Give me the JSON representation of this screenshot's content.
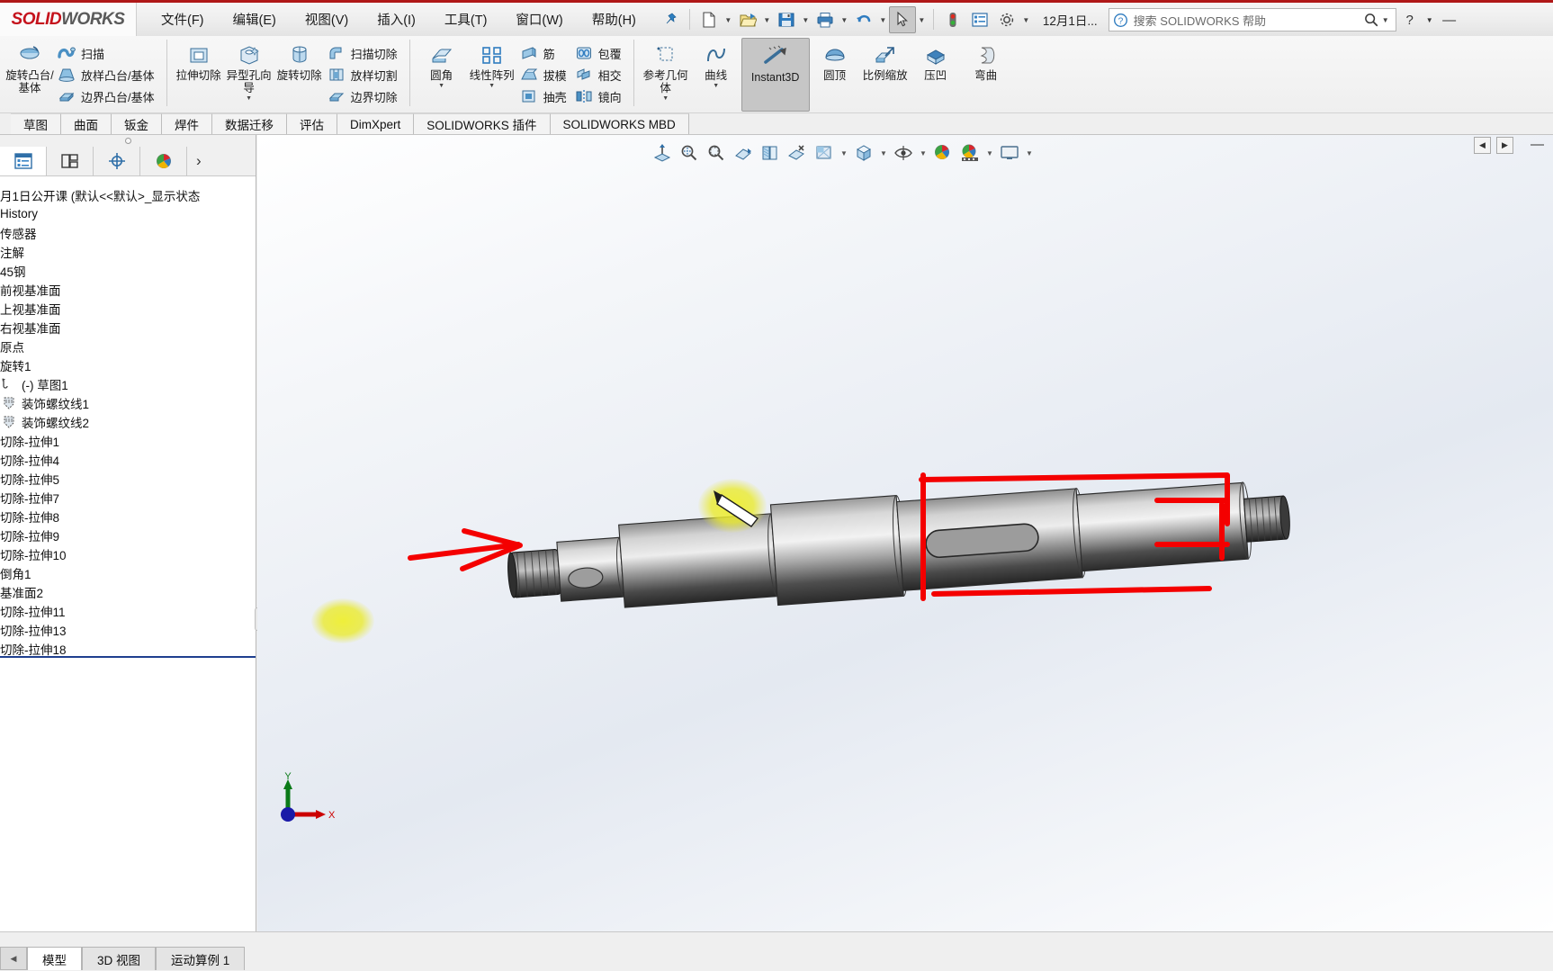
{
  "app": {
    "logo_solid": "SOLID",
    "logo_works": "WORKS"
  },
  "menubar": {
    "items": [
      {
        "label": "文件(F)"
      },
      {
        "label": "编辑(E)"
      },
      {
        "label": "视图(V)"
      },
      {
        "label": "插入(I)"
      },
      {
        "label": "工具(T)"
      },
      {
        "label": "窗口(W)"
      },
      {
        "label": "帮助(H)"
      }
    ],
    "pin_icon": "pushpin-icon"
  },
  "quickaccess": {
    "buttons": [
      {
        "name": "new-document-button",
        "icon": "new-document-icon",
        "caret": true
      },
      {
        "name": "open-document-button",
        "icon": "open-folder-icon",
        "caret": true
      },
      {
        "name": "save-button",
        "icon": "save-floppy-icon",
        "caret": true
      },
      {
        "name": "print-button",
        "icon": "printer-icon",
        "caret": true
      },
      {
        "name": "undo-button",
        "icon": "undo-arrow-icon",
        "caret": true
      },
      {
        "name": "select-button",
        "icon": "cursor-arrow-icon",
        "caret": true
      },
      {
        "name": "rebuild-button",
        "icon": "traffic-light-icon",
        "caret": false
      },
      {
        "name": "options-list-button",
        "icon": "list-properties-icon",
        "caret": false
      },
      {
        "name": "settings-button",
        "icon": "gear-icon",
        "caret": true
      }
    ],
    "document_title": "12月1日...",
    "help_search_placeholder": "搜索 SOLIDWORKS 帮助",
    "help_icon": "question-circle-icon",
    "search_icon": "magnifier-icon",
    "help_button": "?",
    "minimize_label": "—"
  },
  "ribbon": {
    "groups": [
      {
        "big": [
          {
            "label": "旋转凸台/基体",
            "icon": "revolve-boss-icon",
            "caret": false
          }
        ],
        "small": [
          {
            "label": "扫描",
            "icon": "sweep-icon"
          },
          {
            "label": "放样凸台/基体",
            "icon": "loft-boss-icon"
          },
          {
            "label": "边界凸台/基体",
            "icon": "boundary-boss-icon"
          }
        ]
      },
      {
        "big": [
          {
            "label": "拉伸切除",
            "icon": "extruded-cut-icon",
            "caret": false
          },
          {
            "label": "异型孔向导",
            "icon": "hole-wizard-icon",
            "caret": true
          },
          {
            "label": "旋转切除",
            "icon": "revolved-cut-icon",
            "caret": false
          }
        ],
        "small": [
          {
            "label": "扫描切除",
            "icon": "swept-cut-icon"
          },
          {
            "label": "放样切割",
            "icon": "lofted-cut-icon"
          },
          {
            "label": "边界切除",
            "icon": "boundary-cut-icon"
          }
        ]
      },
      {
        "big": [
          {
            "label": "圆角",
            "icon": "fillet-icon",
            "caret": true
          },
          {
            "label": "线性阵列",
            "icon": "linear-pattern-icon",
            "caret": true
          }
        ],
        "small": [
          {
            "label": "筋",
            "icon": "rib-icon"
          },
          {
            "label": "拔模",
            "icon": "draft-icon"
          },
          {
            "label": "抽壳",
            "icon": "shell-icon"
          }
        ],
        "small2": [
          {
            "label": "包覆",
            "icon": "wrap-icon"
          },
          {
            "label": "相交",
            "icon": "intersect-icon"
          },
          {
            "label": "镜向",
            "icon": "mirror-icon"
          }
        ]
      },
      {
        "big": [
          {
            "label": "参考几何体",
            "icon": "reference-geometry-icon",
            "caret": true
          },
          {
            "label": "曲线",
            "icon": "curves-icon",
            "caret": true
          },
          {
            "label": "Instant3D",
            "icon": "instant3d-icon",
            "caret": false,
            "active": true
          },
          {
            "label": "圆顶",
            "icon": "dome-icon",
            "caret": false
          },
          {
            "label": "比例缩放",
            "icon": "scale-icon",
            "caret": false
          },
          {
            "label": "压凹",
            "icon": "indent-icon",
            "caret": false
          },
          {
            "label": "弯曲",
            "icon": "flex-icon",
            "caret": false
          }
        ],
        "small": []
      }
    ]
  },
  "command_tabs": {
    "items": [
      {
        "label": "草图"
      },
      {
        "label": "曲面"
      },
      {
        "label": "钣金"
      },
      {
        "label": "焊件"
      },
      {
        "label": "数据迁移"
      },
      {
        "label": "评估"
      },
      {
        "label": "DimXpert"
      },
      {
        "label": "SOLIDWORKS 插件"
      },
      {
        "label": "SOLIDWORKS MBD"
      }
    ]
  },
  "left_panel": {
    "tabs": [
      {
        "name": "feature-manager-tab",
        "icon": "feature-tree-icon",
        "selected": true
      },
      {
        "name": "property-manager-tab",
        "icon": "property-manager-icon",
        "selected": false
      },
      {
        "name": "configuration-manager-tab",
        "icon": "configuration-icon",
        "selected": false
      },
      {
        "name": "display-manager-tab",
        "icon": "display-palette-icon",
        "selected": false
      }
    ],
    "expand_arrow": "›",
    "tree": [
      {
        "label": "月1日公开课  (默认<<默认>_显示状态",
        "icon": "part-icon",
        "indent": 0
      },
      {
        "label": "History",
        "icon": "history-icon",
        "indent": 0
      },
      {
        "label": "传感器",
        "icon": "sensors-icon",
        "indent": 0
      },
      {
        "label": "注解",
        "icon": "annotations-icon",
        "indent": 0
      },
      {
        "label": "45钢",
        "icon": "material-icon",
        "indent": 0
      },
      {
        "label": "前视基准面",
        "icon": "plane-icon",
        "indent": 0
      },
      {
        "label": "上视基准面",
        "icon": "plane-icon",
        "indent": 0
      },
      {
        "label": "右视基准面",
        "icon": "plane-icon",
        "indent": 0
      },
      {
        "label": "原点",
        "icon": "origin-icon",
        "indent": 0
      },
      {
        "label": "旋转1",
        "icon": "revolve-feature-icon",
        "indent": 0
      },
      {
        "label": "(-) 草图1",
        "icon": "sketch-icon",
        "indent": 1
      },
      {
        "label": "装饰螺纹线1",
        "icon": "cosmetic-thread-icon",
        "indent": 1
      },
      {
        "label": "装饰螺纹线2",
        "icon": "cosmetic-thread-icon",
        "indent": 1
      },
      {
        "label": "切除-拉伸1",
        "icon": "extrude-cut-feature-icon",
        "indent": 0
      },
      {
        "label": "切除-拉伸4",
        "icon": "extrude-cut-feature-icon",
        "indent": 0
      },
      {
        "label": "切除-拉伸5",
        "icon": "extrude-cut-feature-icon",
        "indent": 0
      },
      {
        "label": "切除-拉伸7",
        "icon": "extrude-cut-feature-icon",
        "indent": 0
      },
      {
        "label": "切除-拉伸8",
        "icon": "extrude-cut-feature-icon",
        "indent": 0
      },
      {
        "label": "切除-拉伸9",
        "icon": "extrude-cut-feature-icon",
        "indent": 0
      },
      {
        "label": "切除-拉伸10",
        "icon": "extrude-cut-feature-icon",
        "indent": 0
      },
      {
        "label": "倒角1",
        "icon": "chamfer-feature-icon",
        "indent": 0
      },
      {
        "label": "基准面2",
        "icon": "plane-icon",
        "indent": 0
      },
      {
        "label": "切除-拉伸11",
        "icon": "extrude-cut-feature-icon",
        "indent": 0
      },
      {
        "label": "切除-拉伸13",
        "icon": "extrude-cut-feature-icon",
        "indent": 0
      },
      {
        "label": "切除-拉伸18",
        "icon": "extrude-cut-feature-icon",
        "indent": 0
      }
    ],
    "hscroll_grip": "⋯"
  },
  "heads_up_toolbar": {
    "buttons": [
      {
        "name": "zoom-to-fit-button",
        "icon": "zoom-to-fit-icon",
        "caret": false
      },
      {
        "name": "zoom-to-area-button",
        "icon": "zoom-to-area-icon",
        "caret": false
      },
      {
        "name": "previous-view-button",
        "icon": "previous-view-icon",
        "caret": false
      },
      {
        "name": "section-view-button",
        "icon": "section-view-icon",
        "caret": false
      },
      {
        "name": "view-orientation-button",
        "icon": "view-orientation-icon",
        "caret": false
      },
      {
        "name": "display-style-button",
        "icon": "display-style-icon",
        "caret": false
      },
      {
        "name": "hide-show-items-button",
        "icon": "hide-show-items-icon",
        "caret": true
      },
      {
        "name": "view-settings-button",
        "icon": "view-cube-icon",
        "caret": true
      },
      {
        "name": "hide-show-toggle-button",
        "icon": "eye-icon",
        "caret": true
      },
      {
        "name": "apply-scene-button",
        "icon": "scene-palette-icon",
        "caret": false
      },
      {
        "name": "view-settings2-button",
        "icon": "appearance-palette-icon",
        "caret": true
      },
      {
        "name": "display-full-screen-button",
        "icon": "monitor-icon",
        "caret": true
      }
    ],
    "collapse_left": "◀",
    "collapse_right": "▶",
    "minimize": "—"
  },
  "model": {
    "triad": {
      "x_label": "X",
      "y_label": "Y"
    },
    "annotations": {
      "color": "#f40000",
      "highlight_color": "#ecec33",
      "arrow_note": "red-arrow-pointing-left-end",
      "bracket_note": "red-dimension-bracket-right-section"
    }
  },
  "bottom": {
    "nav_icon": "◀",
    "tabs": [
      {
        "label": "模型",
        "selected": true
      },
      {
        "label": "3D 视图",
        "selected": false
      },
      {
        "label": "运动算例 1",
        "selected": false
      }
    ]
  }
}
